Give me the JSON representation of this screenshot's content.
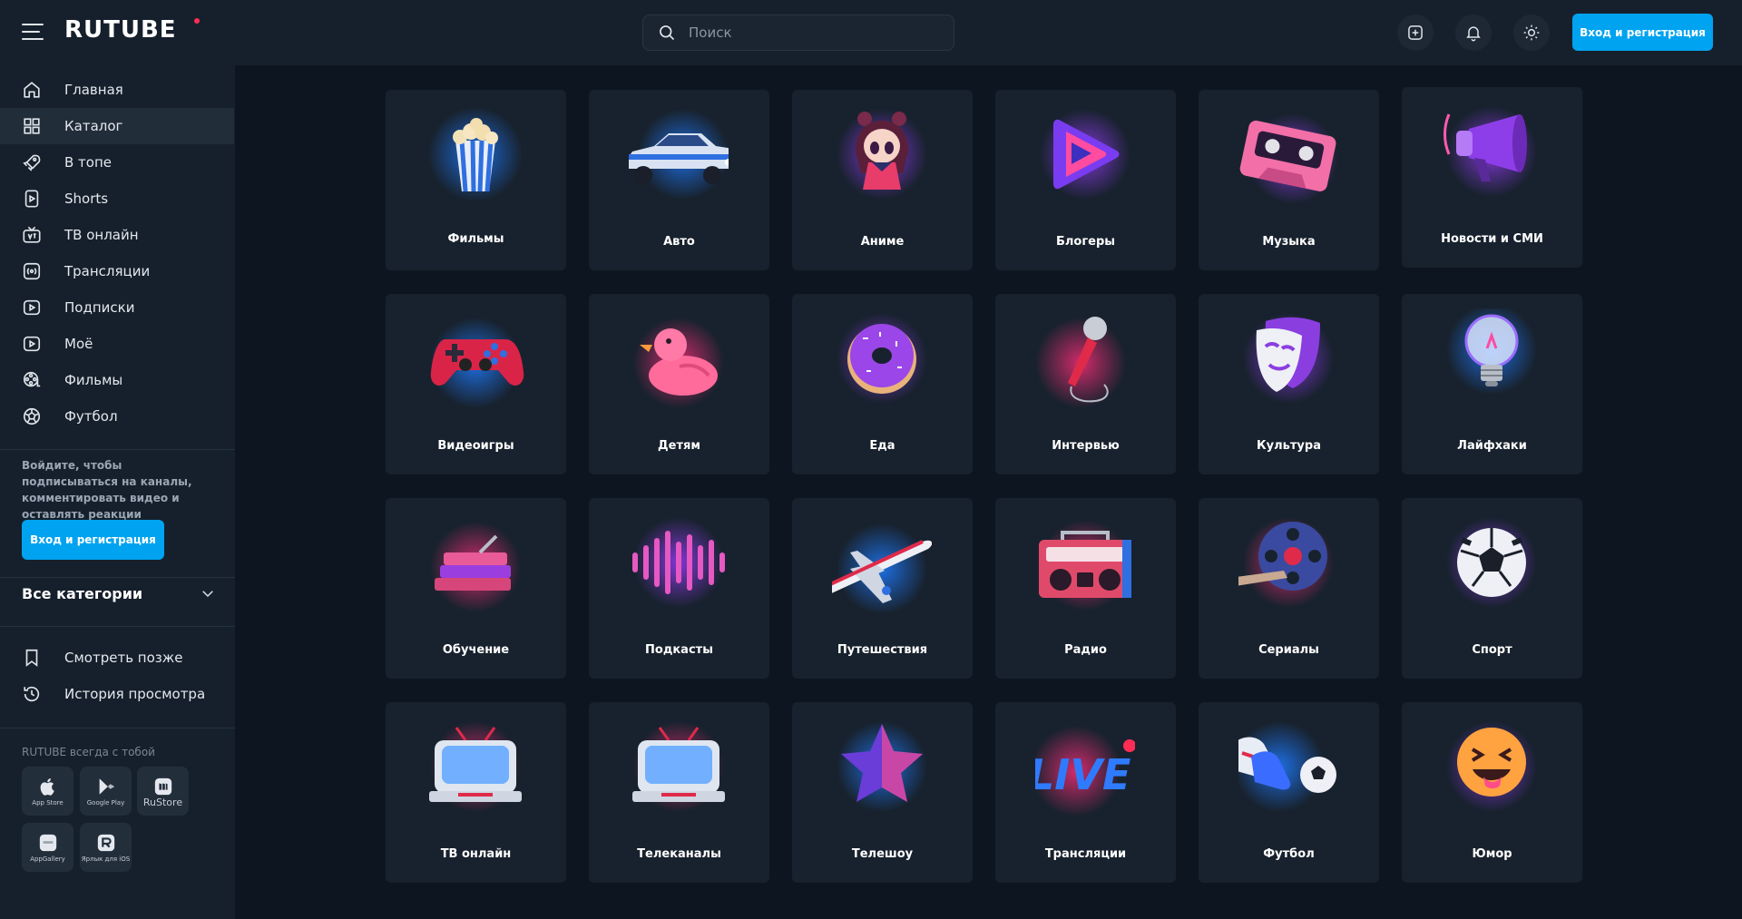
{
  "header": {
    "logo": "RUTUBE",
    "search_placeholder": "Поиск",
    "login_label": "Вход и регистрация"
  },
  "sidebar": {
    "nav": [
      {
        "label": "Главная",
        "icon": "home-icon"
      },
      {
        "label": "Каталог",
        "icon": "grid-icon",
        "active": true
      },
      {
        "label": "В топе",
        "icon": "rocket-icon"
      },
      {
        "label": "Shorts",
        "icon": "shorts-icon"
      },
      {
        "label": "ТВ онлайн",
        "icon": "tv-icon"
      },
      {
        "label": "Трансляции",
        "icon": "broadcast-icon"
      },
      {
        "label": "Подписки",
        "icon": "subscriptions-icon"
      },
      {
        "label": "Моё",
        "icon": "my-videos-icon"
      },
      {
        "label": "Фильмы",
        "icon": "film-reel-icon"
      },
      {
        "label": "Футбол",
        "icon": "football-icon"
      }
    ],
    "promo_text": "Войдите, чтобы подписываться на каналы, комментировать видео и оставлять реакции",
    "login_label": "Вход и регистрация",
    "all_categories": "Все категории",
    "secondary": [
      {
        "label": "Смотреть позже",
        "icon": "bookmark-icon"
      },
      {
        "label": "История просмотра",
        "icon": "history-icon"
      }
    ],
    "apps_title": "RUTUBE всегда с тобой",
    "apps": [
      {
        "label": "App Store",
        "icon": "apple-icon"
      },
      {
        "label": "Google Play",
        "icon": "google-play-icon"
      },
      {
        "label": "RuStore",
        "icon": "rustore-icon"
      },
      {
        "label": "AppGallery",
        "icon": "huawei-icon"
      },
      {
        "label": "Ярлык для iOS",
        "icon": "rutube-shortcut-icon"
      }
    ]
  },
  "categories": [
    {
      "label": "Фильмы",
      "icon": "popcorn-icon"
    },
    {
      "label": "Авто",
      "icon": "car-icon"
    },
    {
      "label": "Аниме",
      "icon": "anime-girl-icon"
    },
    {
      "label": "Блогеры",
      "icon": "play-icon"
    },
    {
      "label": "Музыка",
      "icon": "cassette-icon"
    },
    {
      "label": "Новости и СМИ",
      "icon": "megaphone-icon"
    },
    {
      "label": "Видеоигры",
      "icon": "gamepad-icon"
    },
    {
      "label": "Детям",
      "icon": "rubber-duck-icon"
    },
    {
      "label": "Еда",
      "icon": "donut-icon"
    },
    {
      "label": "Интервью",
      "icon": "microphone-icon"
    },
    {
      "label": "Культура",
      "icon": "theater-mask-icon"
    },
    {
      "label": "Лайфхаки",
      "icon": "lightbulb-icon"
    },
    {
      "label": "Обучение",
      "icon": "books-icon"
    },
    {
      "label": "Подкасты",
      "icon": "soundwave-icon"
    },
    {
      "label": "Путешествия",
      "icon": "airplane-icon"
    },
    {
      "label": "Радио",
      "icon": "boombox-icon"
    },
    {
      "label": "Сериалы",
      "icon": "film-reel-icon"
    },
    {
      "label": "Спорт",
      "icon": "soccer-ball-icon"
    },
    {
      "label": "ТВ онлайн",
      "icon": "retro-tv-icon"
    },
    {
      "label": "Телеканалы",
      "icon": "retro-tv-icon"
    },
    {
      "label": "Телешоу",
      "icon": "star-icon"
    },
    {
      "label": "Трансляции",
      "icon": "live-icon"
    },
    {
      "label": "Футбол",
      "icon": "boots-ball-icon"
    },
    {
      "label": "Юмор",
      "icon": "laughing-emoji-icon"
    }
  ],
  "colors": {
    "accent": "#00a3f0",
    "background": "#0d1620",
    "panel": "#16202c",
    "card": "#18222e"
  }
}
